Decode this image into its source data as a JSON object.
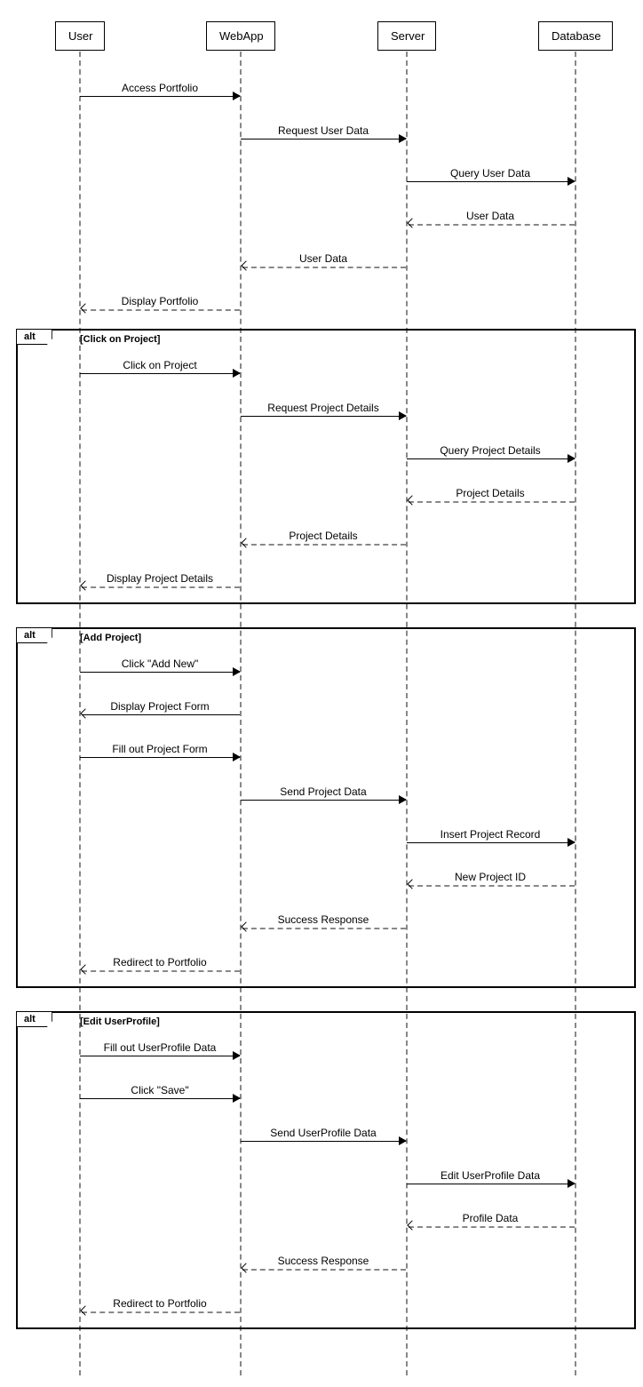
{
  "actors": {
    "user": "User",
    "webapp": "WebApp",
    "server": "Server",
    "database": "Database"
  },
  "messages": {
    "m1": "Access Portfolio",
    "m2": "Request User Data",
    "m3": "Query User Data",
    "m4": "User Data",
    "m5": "User Data",
    "m6": "Display Portfolio",
    "m7": "Click on Project",
    "m8": "Request Project Details",
    "m9": "Query Project Details",
    "m10": "Project Details",
    "m11": "Project Details",
    "m12": "Display Project Details",
    "m13": "Click \"Add New\"",
    "m14": "Display Project Form",
    "m15": "Fill out Project Form",
    "m16": "Send Project Data",
    "m17": "Insert Project Record",
    "m18": "New Project ID",
    "m19": "Success Response",
    "m20": "Redirect to Portfolio",
    "m21": "Fill out UserProfile Data",
    "m22": "Click \"Save\"",
    "m23": "Send UserProfile Data",
    "m24": "Edit UserProfile Data",
    "m25": "Profile Data",
    "m26": "Success Response",
    "m27": "Redirect to Portfolio"
  },
  "alts": {
    "label": "alt",
    "cond1": "[Click on Project]",
    "cond2": "[Add Project]",
    "cond3": "[Edit UserProfile]"
  }
}
